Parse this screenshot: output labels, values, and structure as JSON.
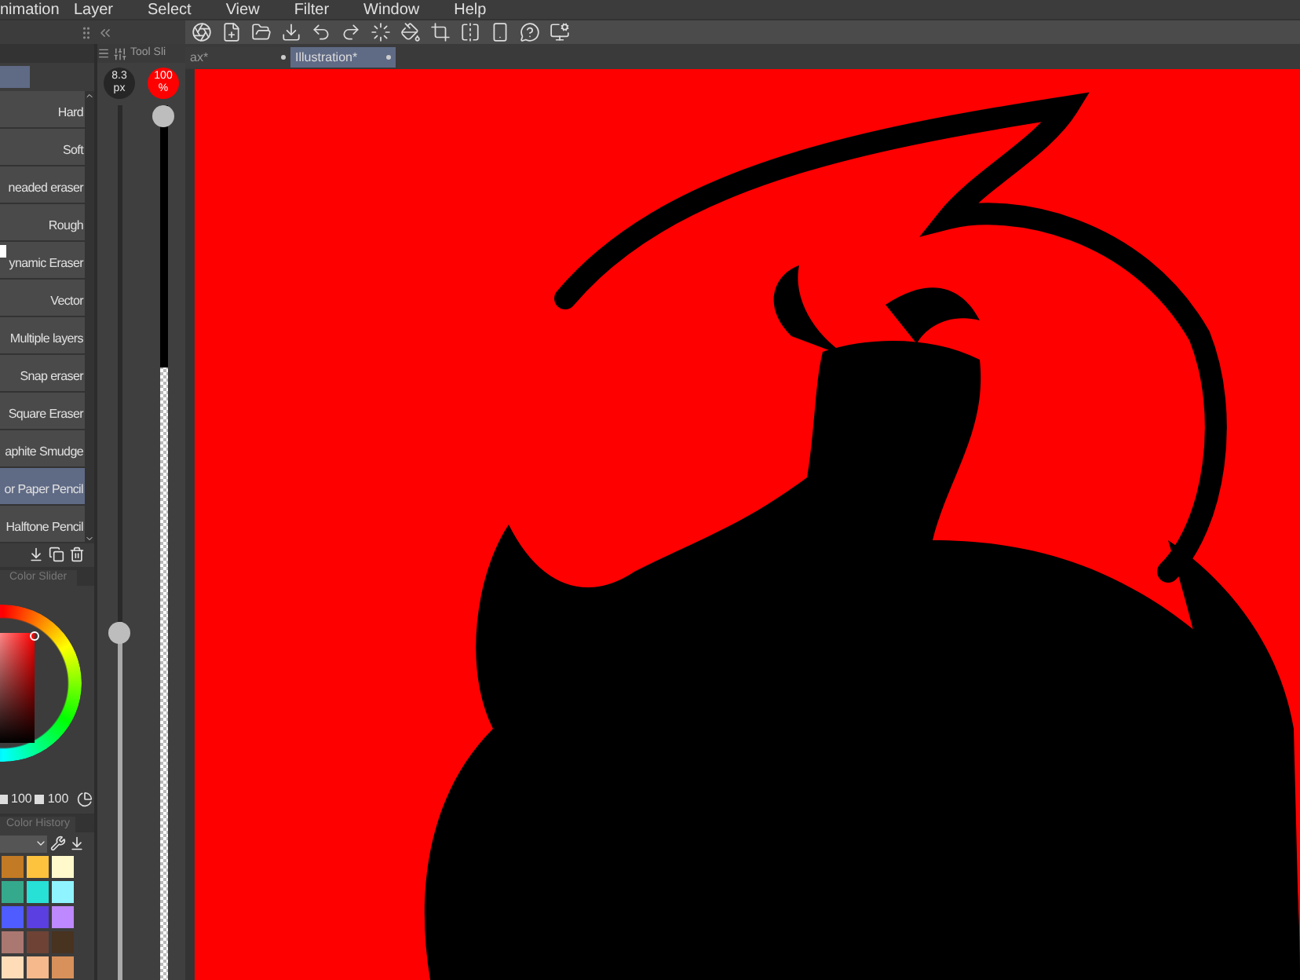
{
  "menu": [
    "nimation",
    "Layer",
    "Select",
    "View",
    "Filter",
    "Window",
    "Help"
  ],
  "document_tabs": [
    {
      "label": "ax*",
      "selected": false
    },
    {
      "label": "Illustration*",
      "selected": true
    }
  ],
  "subtools": [
    {
      "label": "Hard",
      "selected": false
    },
    {
      "label": "Soft",
      "selected": false
    },
    {
      "label": "neaded eraser",
      "selected": false
    },
    {
      "label": "Rough",
      "selected": false
    },
    {
      "label": "ynamic Eraser",
      "selected": false
    },
    {
      "label": "Vector",
      "selected": false
    },
    {
      "label": "Multiple layers",
      "selected": false
    },
    {
      "label": "Snap eraser",
      "selected": false
    },
    {
      "label": "Square Eraser",
      "selected": false
    },
    {
      "label": "aphite Smudge",
      "selected": false
    },
    {
      "label": "or Paper Pencil",
      "selected": true
    },
    {
      "label": "Halftone Pencil",
      "selected": false
    }
  ],
  "tool_slider": {
    "title": "Tool Sli",
    "size": {
      "value": "8.3",
      "unit": "px",
      "level": 0.41
    },
    "opacity": {
      "value": "100",
      "unit": "%",
      "level": 1
    }
  },
  "color_slider": {
    "tab": "Color Slider",
    "values": [
      "100",
      "100"
    ]
  },
  "color_history": {
    "tab": "Color History",
    "swatches": [
      {
        "color": "#c27a24"
      },
      {
        "color": "#fdc23e"
      },
      {
        "color": "#fff9cc"
      },
      {
        "color": "#35a98b"
      },
      {
        "color": "#27e0d6"
      },
      {
        "color": "#8ff4ff"
      },
      {
        "color": "#4f5cff"
      },
      {
        "color": "#5b3fe0"
      },
      {
        "color": "#be88ff"
      },
      {
        "color": "#ab7771"
      },
      {
        "color": "#6e4335"
      },
      {
        "color": "#483220"
      },
      {
        "color": "#ffdcb8"
      },
      {
        "color": "#f5b98b"
      },
      {
        "color": "#d8915a"
      }
    ]
  }
}
